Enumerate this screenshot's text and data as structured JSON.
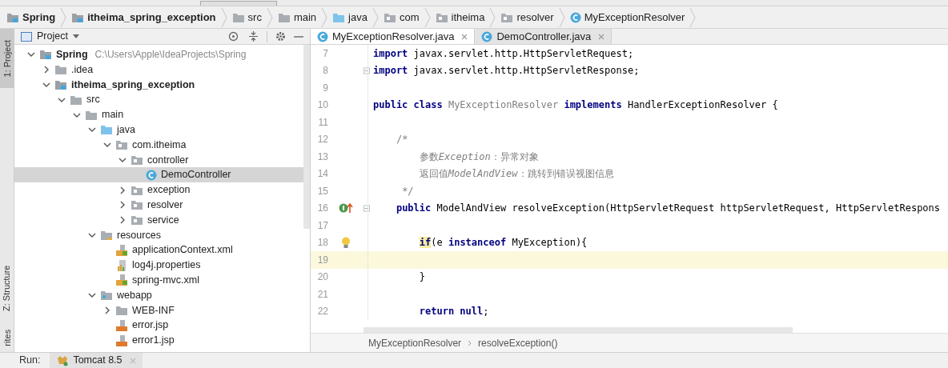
{
  "breadcrumbs": [
    {
      "label": "Spring",
      "kind": "module",
      "bold": true
    },
    {
      "label": "itheima_spring_exception",
      "kind": "module",
      "bold": true
    },
    {
      "label": "src",
      "kind": "folder",
      "bold": false
    },
    {
      "label": "main",
      "kind": "folder",
      "bold": false
    },
    {
      "label": "java",
      "kind": "source",
      "bold": false
    },
    {
      "label": "com",
      "kind": "package",
      "bold": false
    },
    {
      "label": "itheima",
      "kind": "package",
      "bold": false
    },
    {
      "label": "resolver",
      "kind": "package",
      "bold": false
    },
    {
      "label": "MyExceptionResolver",
      "kind": "class",
      "bold": false
    }
  ],
  "side_tabs": [
    {
      "label": "1: Project",
      "selected": true
    },
    {
      "label": "Z: Structure",
      "selected": false
    },
    {
      "label": "rites",
      "selected": false
    }
  ],
  "project_panel": {
    "title": "Project",
    "tree": [
      {
        "label": "Spring",
        "path": "C:\\Users\\Apple\\IdeaProjects\\Spring",
        "kind": "module",
        "bold": true,
        "expanded": true,
        "selected": false,
        "children": [
          {
            "label": ".idea",
            "kind": "folder",
            "bold": false,
            "expanded": false,
            "selected": false
          },
          {
            "label": "itheima_spring_exception",
            "kind": "module",
            "bold": true,
            "expanded": true,
            "selected": false,
            "children": [
              {
                "label": "src",
                "kind": "folder",
                "bold": false,
                "expanded": true,
                "selected": false,
                "children": [
                  {
                    "label": "main",
                    "kind": "folder",
                    "bold": false,
                    "expanded": true,
                    "selected": false,
                    "children": [
                      {
                        "label": "java",
                        "kind": "source",
                        "bold": false,
                        "expanded": true,
                        "selected": false,
                        "children": [
                          {
                            "label": "com.itheima",
                            "kind": "package",
                            "bold": false,
                            "expanded": true,
                            "selected": false,
                            "children": [
                              {
                                "label": "controller",
                                "kind": "package",
                                "bold": false,
                                "expanded": true,
                                "selected": false,
                                "children": [
                                  {
                                    "label": "DemoController",
                                    "kind": "class",
                                    "bold": false,
                                    "selected": true
                                  }
                                ]
                              },
                              {
                                "label": "exception",
                                "kind": "package",
                                "bold": false,
                                "expanded": false,
                                "selected": false
                              },
                              {
                                "label": "resolver",
                                "kind": "package",
                                "bold": false,
                                "expanded": false,
                                "selected": false
                              },
                              {
                                "label": "service",
                                "kind": "package",
                                "bold": false,
                                "expanded": false,
                                "selected": false
                              }
                            ]
                          }
                        ]
                      },
                      {
                        "label": "resources",
                        "kind": "resources",
                        "bold": false,
                        "expanded": true,
                        "selected": false,
                        "children": [
                          {
                            "label": "applicationContext.xml",
                            "kind": "xml",
                            "bold": false,
                            "selected": false
                          },
                          {
                            "label": "log4j.properties",
                            "kind": "properties",
                            "bold": false,
                            "selected": false
                          },
                          {
                            "label": "spring-mvc.xml",
                            "kind": "xml",
                            "bold": false,
                            "selected": false
                          }
                        ]
                      },
                      {
                        "label": "webapp",
                        "kind": "web",
                        "bold": false,
                        "expanded": true,
                        "selected": false,
                        "children": [
                          {
                            "label": "WEB-INF",
                            "kind": "folder",
                            "bold": false,
                            "expanded": false,
                            "selected": false
                          },
                          {
                            "label": "error.jsp",
                            "kind": "jsp",
                            "bold": false,
                            "selected": false
                          },
                          {
                            "label": "error1.jsp",
                            "kind": "jsp",
                            "bold": false,
                            "selected": false
                          }
                        ]
                      }
                    ]
                  }
                ]
              }
            ]
          }
        ]
      }
    ]
  },
  "editor_tabs": [
    {
      "label": "MyExceptionResolver.java",
      "selected": true
    },
    {
      "label": "DemoController.java",
      "selected": false
    }
  ],
  "code": [
    {
      "number": "7",
      "fold": false,
      "current": false,
      "tokens": [
        {
          "kind": "keyword",
          "text": "import"
        },
        {
          "kind": "plain",
          "text": " javax.servlet.http.HttpServletRequest;"
        }
      ]
    },
    {
      "number": "8",
      "fold": true,
      "current": false,
      "tokens": [
        {
          "kind": "keyword",
          "text": "import"
        },
        {
          "kind": "plain",
          "text": " javax.servlet.http.HttpServletResponse;"
        }
      ]
    },
    {
      "number": "9",
      "fold": false,
      "current": false
    },
    {
      "number": "10",
      "fold": false,
      "current": false,
      "tokens": [
        {
          "kind": "keyword",
          "text": "public class "
        },
        {
          "kind": "unused",
          "text": "MyExceptionResolver "
        },
        {
          "kind": "keyword",
          "text": "implements "
        },
        {
          "kind": "plain",
          "text": "HandlerExceptionResolver {"
        }
      ]
    },
    {
      "number": "11",
      "fold": false,
      "current": false
    },
    {
      "number": "12",
      "fold": false,
      "current": false,
      "tokens": [
        {
          "kind": "comment",
          "text": "    /*"
        }
      ]
    },
    {
      "number": "13",
      "fold": false,
      "current": false,
      "tokens": [
        {
          "kind": "comment",
          "text": "        参数"
        },
        {
          "kind": "comment_italic",
          "text": "Exception"
        },
        {
          "kind": "comment",
          "text": "：异常对象"
        }
      ]
    },
    {
      "number": "14",
      "fold": false,
      "current": false,
      "tokens": [
        {
          "kind": "comment",
          "text": "        返回值"
        },
        {
          "kind": "comment_italic",
          "text": "ModelAndView"
        },
        {
          "kind": "comment",
          "text": "：跳转到错误视图信息"
        }
      ]
    },
    {
      "number": "15",
      "fold": false,
      "current": false,
      "tokens": [
        {
          "kind": "comment",
          "text": "     */"
        }
      ]
    },
    {
      "number": "16",
      "fold": true,
      "kind": "override",
      "current": false,
      "tokens": [
        {
          "kind": "keyword",
          "text": "    public "
        },
        {
          "kind": "plain",
          "text": "ModelAndView resolveException(HttpServletRequest httpServletRequest, HttpServletRespons"
        }
      ]
    },
    {
      "number": "17",
      "fold": false,
      "current": false
    },
    {
      "number": "18",
      "fold": false,
      "kind": "bulb",
      "current": false,
      "tokens": [
        {
          "kind": "keyword_hl",
          "text": "        if"
        },
        {
          "kind": "plain",
          "text": "(e "
        },
        {
          "kind": "keyword",
          "text": "instanceof "
        },
        {
          "kind": "plain",
          "text": "MyException){"
        }
      ]
    },
    {
      "number": "19",
      "fold": false,
      "current": true
    },
    {
      "number": "20",
      "fold": false,
      "current": false,
      "tokens": [
        {
          "kind": "plain",
          "text": "        }"
        }
      ]
    },
    {
      "number": "21",
      "fold": false,
      "current": false
    },
    {
      "number": "22",
      "fold": false,
      "current": false,
      "tokens": [
        {
          "kind": "keyword",
          "text": "        return null"
        },
        {
          "kind": "plain",
          "text": ";"
        }
      ]
    }
  ],
  "editor_breadcrumbs": [
    "MyExceptionResolver",
    "resolveException()"
  ],
  "run_bar": {
    "label": "Run:",
    "tab": "Tomcat 8.5"
  }
}
